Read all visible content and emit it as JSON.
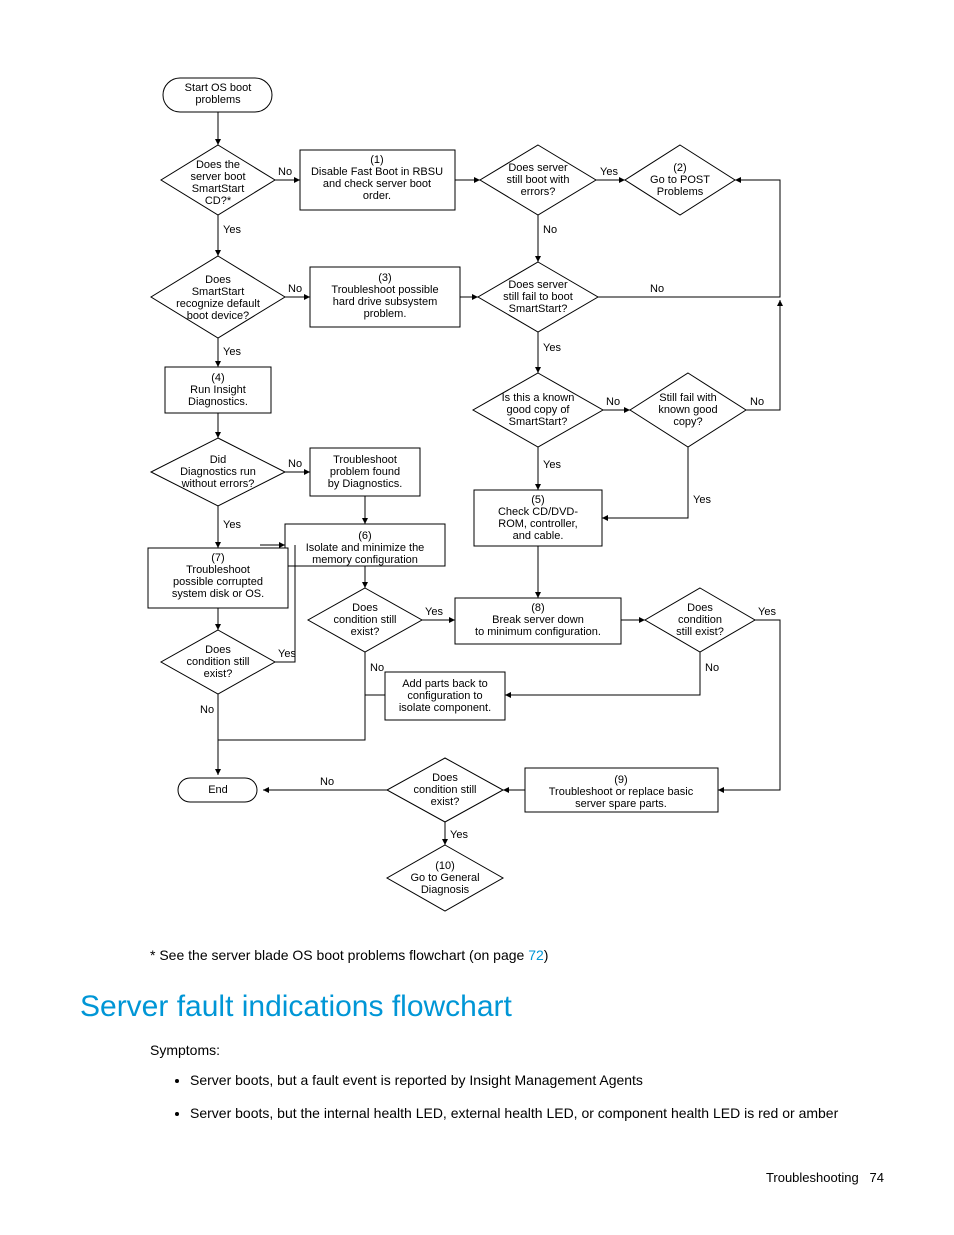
{
  "flowchart": {
    "start": "Start OS boot\nproblems",
    "d_boot_cd": "Does the\nserver boot\nSmartStart\nCD?*",
    "p1": "(1)\nDisable Fast Boot in RBSU\nand check server boot\norder.",
    "d_still_errors": "Does server\nstill boot with\nerrors?",
    "p2": "(2)\nGo to POST\nProblems",
    "d_recognize": "Does\nSmartStart\nrecognize default\nboot device?",
    "p3": "(3)\nTroubleshoot possible\nhard drive subsystem\nproblem.",
    "d_fail_smartstart": "Does server\nstill fail to boot\nSmartStart?",
    "p4": "(4)\nRun Insight\nDiagnostics.",
    "d_known_copy": "Is this a known\ngood copy of\nSmartStart?",
    "d_still_fail_copy": "Still fail with\nknown good\ncopy?",
    "d_diag_errors": "Did\nDiagnostics run\nwithout errors?",
    "p_troubleshoot_diag": "Troubleshoot\nproblem found\nby Diagnostics.",
    "p5": "(5)\nCheck CD/DVD-\nROM, controller,\nand cable.",
    "p6": "(6)\nIsolate and minimize the\nmemory configuration",
    "p7": "(7)\nTroubleshoot\npossible corrupted\nsystem disk or OS.",
    "d_cond_exist_left": "Does\ncondition still\nexist?",
    "d_cond_exist_mid": "Does\ncondition still\nexist?",
    "p8": "(8)\nBreak server down\nto minimum configuration.",
    "d_cond_exist_right": "Does\ncondition\nstill exist?",
    "p_add_parts": "Add parts back to\nconfiguration to\nisolate component.",
    "p9": "(9)\nTroubleshoot or replace basic\nserver spare parts.",
    "d_cond_exist_final": "Does\ncondition still\nexist?",
    "p10": "(10)\nGo to General\nDiagnosis",
    "end": "End",
    "yes": "Yes",
    "no": "No"
  },
  "footnote_pre": "* See the server blade OS boot problems flowchart (on page ",
  "footnote_link": "72",
  "footnote_post": ")",
  "heading": "Server fault indications flowchart",
  "symptoms_label": "Symptoms:",
  "bullets": [
    "Server boots, but a fault event is reported by Insight Management Agents",
    "Server boots, but the internal health LED, external health LED, or component health LED is red or amber"
  ],
  "footer_section": "Troubleshooting",
  "footer_page": "74"
}
